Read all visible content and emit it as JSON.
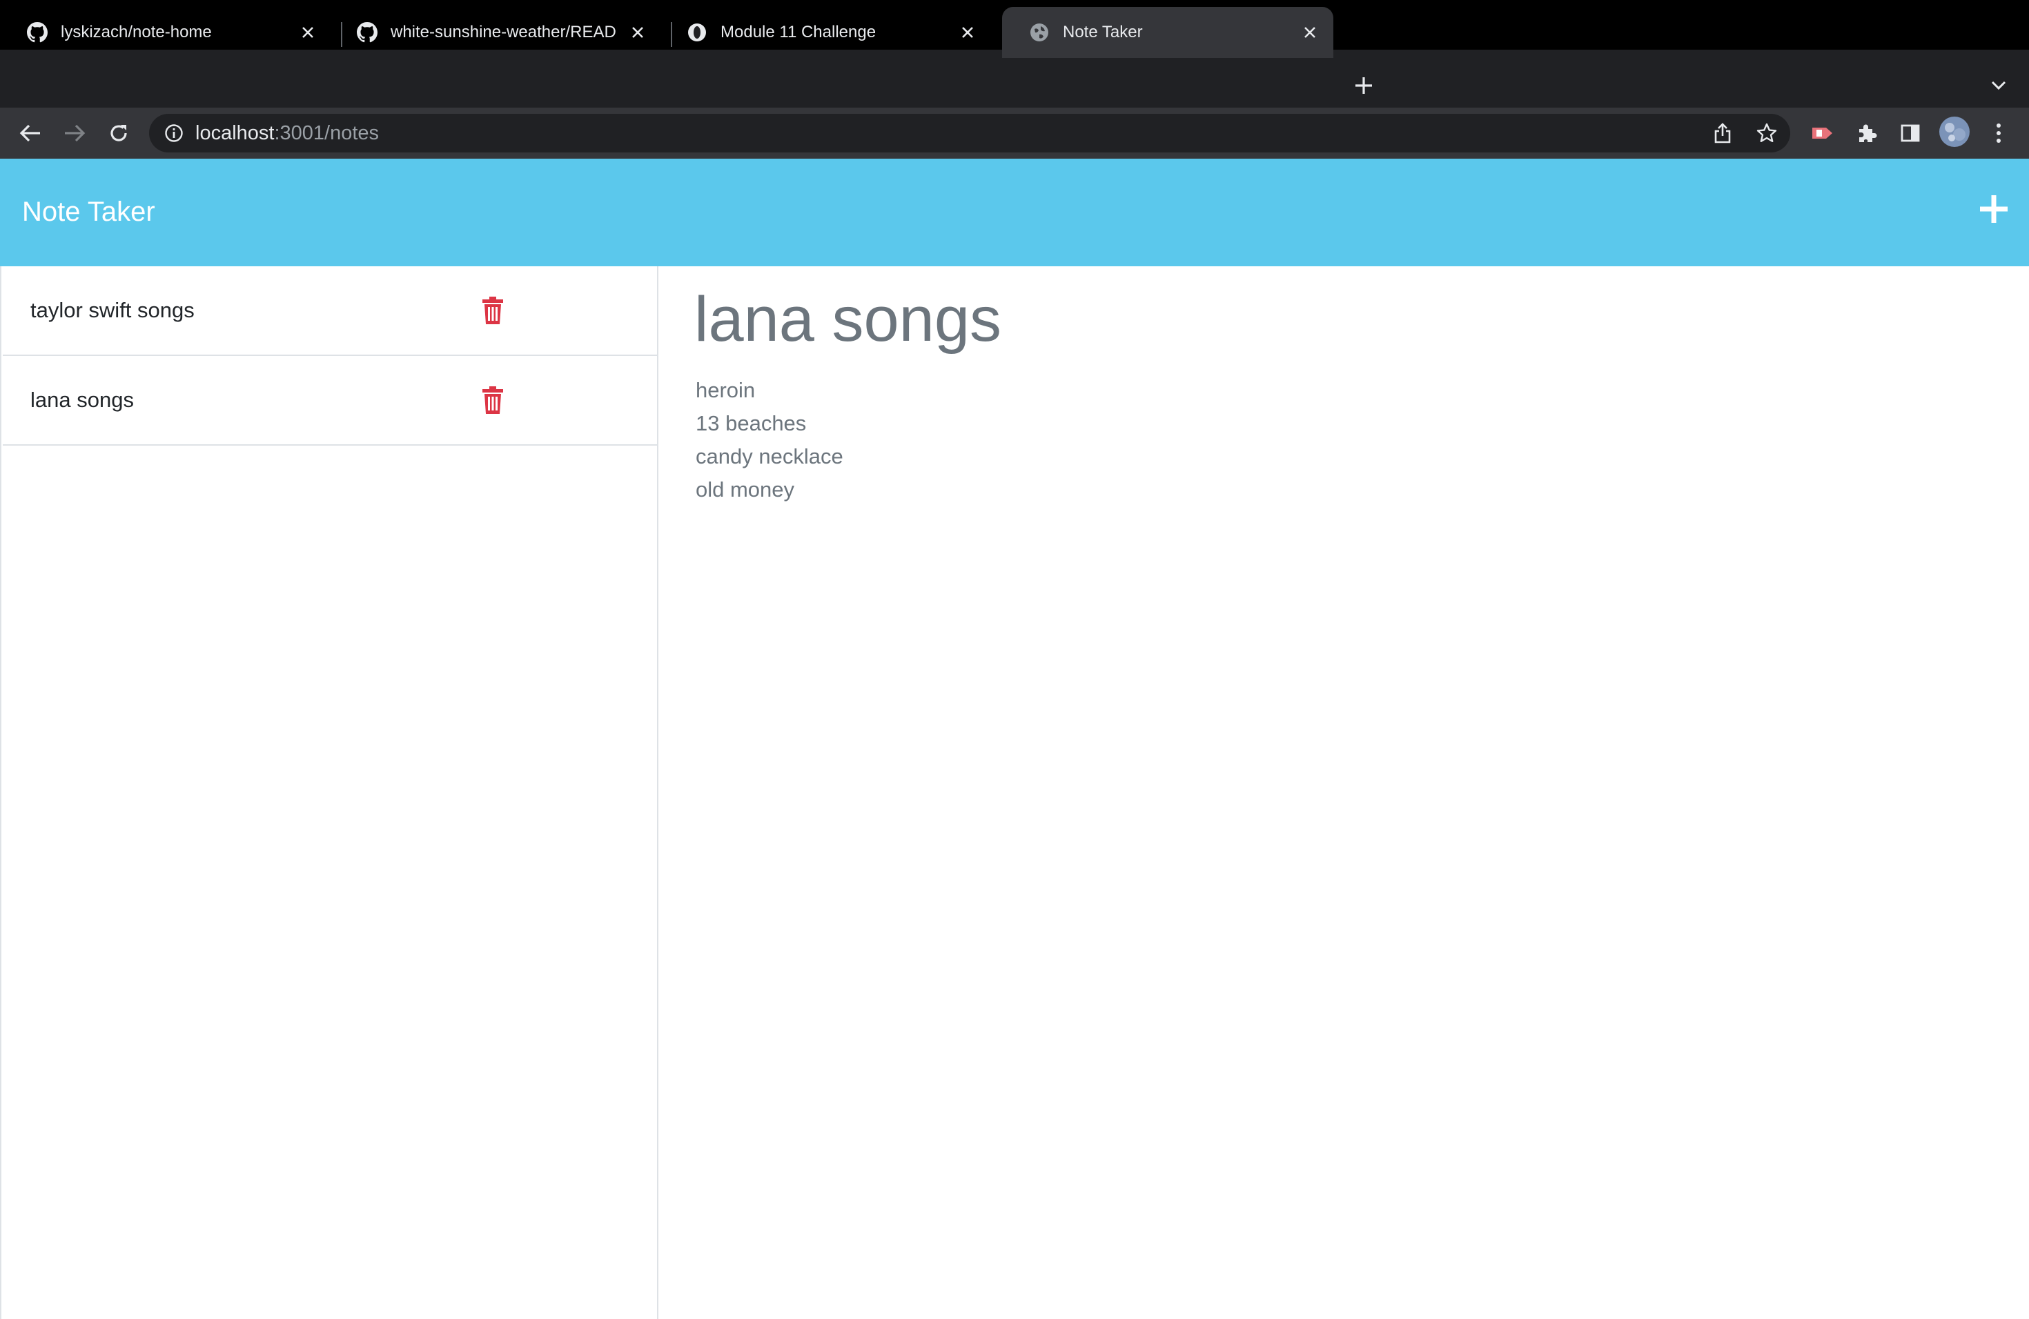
{
  "browser": {
    "tabs": [
      {
        "title": "lyskizach/note-home",
        "favicon": "github-icon",
        "active": false
      },
      {
        "title": "white-sunshine-weather/READ",
        "favicon": "github-icon",
        "active": false
      },
      {
        "title": "Module 11 Challenge",
        "favicon": "circle-logo-icon",
        "active": false
      },
      {
        "title": "Note Taker",
        "favicon": "globe-icon",
        "active": true
      }
    ],
    "url_host": "localhost",
    "url_rest": ":3001/notes"
  },
  "app": {
    "title": "Note Taker"
  },
  "notes": [
    {
      "title": "taylor swift songs"
    },
    {
      "title": "lana songs"
    }
  ],
  "active_note": {
    "title": "lana songs",
    "body": "heroin\n13 beaches\ncandy necklace\nold money"
  },
  "colors": {
    "header": "#5bc8ec",
    "delete_icon": "#dc3545",
    "note_text": "#6c757d"
  }
}
